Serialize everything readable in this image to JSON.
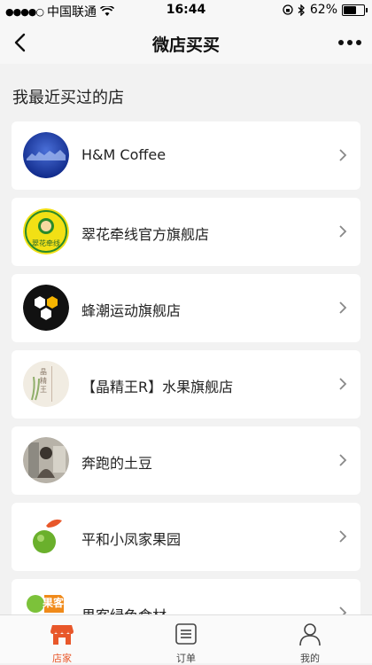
{
  "status_bar": {
    "carrier": "中国联通",
    "time": "16:44",
    "battery": "62%",
    "battery_level": 0.62,
    "signal_icon": "signal-dots-icon",
    "wifi_icon": "wifi-icon"
  },
  "nav": {
    "title": "微店买买",
    "back_icon": "back-arrow-icon",
    "more_icon": "more-icon"
  },
  "section_title": "我最近买过的店",
  "shops": [
    {
      "name": "H&M Coffee",
      "logo": "hm-coffee-logo"
    },
    {
      "name": "翠花牵线官方旗舰店",
      "logo": "cuihua-logo",
      "logo_text": "翠花牵线"
    },
    {
      "name": "蜂潮运动旗舰店",
      "logo": "fengchao-logo"
    },
    {
      "name": "【晶精王R】水果旗舰店",
      "logo": "jingjingwang-logo",
      "logo_text": "晶精王"
    },
    {
      "name": "奔跑的土豆",
      "logo": "bendou-avatar"
    },
    {
      "name": "平和小凤家果园",
      "logo": "pinghe-logo"
    },
    {
      "name": "果客绿色食材",
      "logo": "guoke-logo",
      "logo_text": "果客"
    }
  ],
  "tabs": [
    {
      "label": "店家",
      "icon": "store-icon",
      "active": true
    },
    {
      "label": "订单",
      "icon": "order-list-icon",
      "active": false
    },
    {
      "label": "我的",
      "icon": "profile-icon",
      "active": false
    }
  ],
  "colors": {
    "accent": "#e8572a",
    "background": "#f2f2f2"
  }
}
